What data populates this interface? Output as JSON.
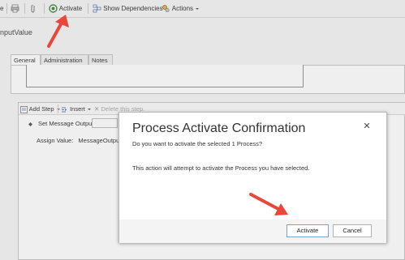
{
  "toolbar": {
    "left_edge_label": "e",
    "activate_label": "Activate",
    "show_dependencies_label": "Show Dependencies",
    "actions_label": "Actions"
  },
  "form": {
    "field_label": "nputValue"
  },
  "tabs": [
    {
      "label": "General"
    },
    {
      "label": "Administration"
    },
    {
      "label": "Notes"
    }
  ],
  "steps": {
    "add_step_label": "Add Step",
    "insert_label": "Insert",
    "delete_label": "Delete this step.",
    "step_name": "Set Message Output",
    "assign_label": "Assign Value:",
    "assign_value": "MessageOutput"
  },
  "dialog": {
    "title": "Process Activate Confirmation",
    "subtitle": "Do you want to activate the selected 1 Process?",
    "message": "This action will attempt to activate the Process you have selected.",
    "activate_button": "Activate",
    "cancel_button": "Cancel",
    "close_glyph": "✕"
  },
  "colors": {
    "annotation_arrow": "#e8473a",
    "activate_icon": "#3a8a3a",
    "dialog_button_border": "#7ea3cf"
  }
}
